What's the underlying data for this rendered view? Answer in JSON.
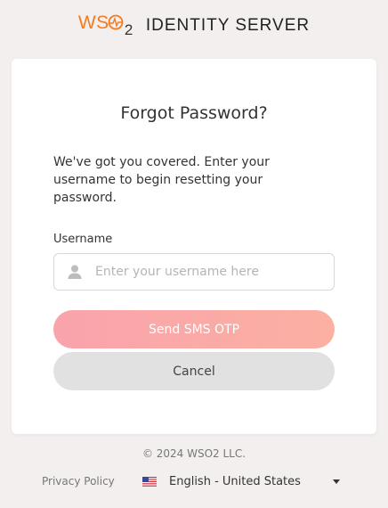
{
  "logo": {
    "wso": "WS",
    "two": "2",
    "product": "IDENTITY SERVER"
  },
  "colors": {
    "brand": "#f47b20",
    "primary_button": "#f9a3ac",
    "cancel_button": "#e1e1e1"
  },
  "form": {
    "title": "Forgot Password?",
    "description": "We've got you covered. Enter your username to begin resetting your password.",
    "username_label": "Username",
    "username_placeholder": "Enter your username here",
    "username_value": "",
    "user_icon": "user-icon",
    "submit_label": "Send SMS OTP",
    "cancel_label": "Cancel"
  },
  "footer": {
    "copyright": "© 2024 WSO2 LLC.",
    "privacy": "Privacy Policy",
    "language": "English - United States",
    "flag_icon": "us-flag-icon"
  }
}
